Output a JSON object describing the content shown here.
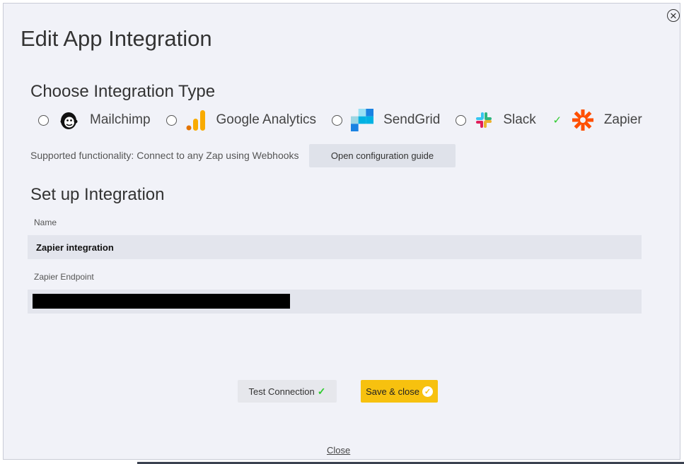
{
  "dialog": {
    "title": "Edit App Integration",
    "close_link": "Close"
  },
  "integration_type": {
    "heading": "Choose Integration Type",
    "options": [
      {
        "label": "Mailchimp",
        "icon": "mailchimp-logo-icon",
        "selected": false
      },
      {
        "label": "Google Analytics",
        "icon": "google-analytics-logo-icon",
        "selected": false
      },
      {
        "label": "SendGrid",
        "icon": "sendgrid-logo-icon",
        "selected": false
      },
      {
        "label": "Slack",
        "icon": "slack-logo-icon",
        "selected": false
      },
      {
        "label": "Zapier",
        "icon": "zapier-logo-icon",
        "selected": true
      }
    ],
    "supported_text": "Supported functionality: Connect to any Zap using Webhooks",
    "guide_button": "Open configuration guide"
  },
  "setup": {
    "heading": "Set up Integration",
    "name_label": "Name",
    "name_value": "Zapier integration",
    "endpoint_label": "Zapier Endpoint",
    "endpoint_value": ""
  },
  "actions": {
    "test_label": "Test Connection",
    "save_label": "Save & close"
  },
  "colors": {
    "accent": "#f7c10f",
    "success": "#2ecc2e",
    "zapier": "#ff4f00",
    "analytics": "#f9ab00",
    "sendgrid": "#1a82e2"
  }
}
